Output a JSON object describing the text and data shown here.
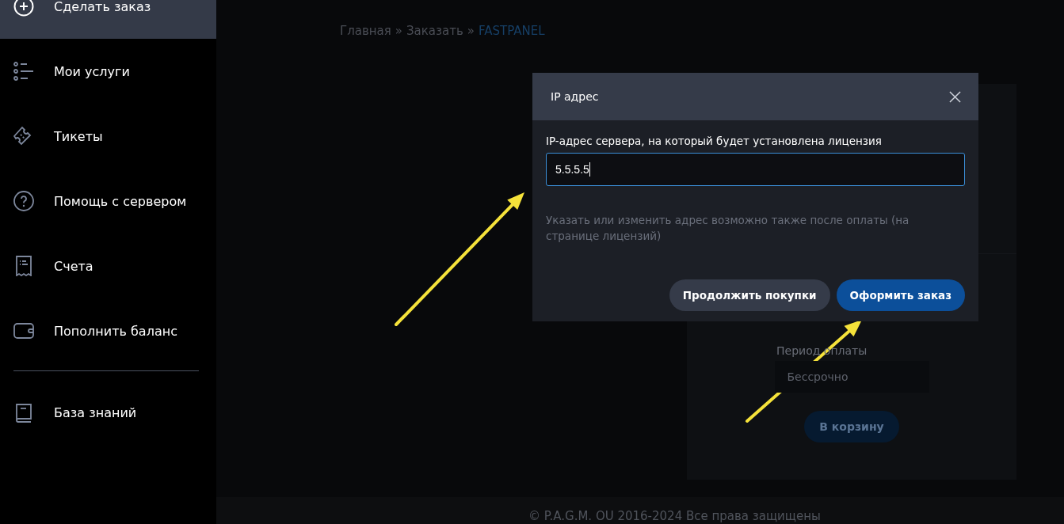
{
  "sidebar": {
    "groups": [
      {
        "items": [
          {
            "label": "Сделать заказ",
            "selected": true
          },
          {
            "label": "Мои услуги",
            "selected": false
          },
          {
            "label": "Тикеты",
            "selected": false
          },
          {
            "label": "Помощь с сервером",
            "selected": false
          },
          {
            "label": "Счета",
            "selected": false
          },
          {
            "label": "Пополнить баланс",
            "selected": false
          }
        ]
      },
      {
        "items": [
          {
            "label": "База знаний",
            "selected": false
          }
        ]
      }
    ]
  },
  "breadcrumb": [
    {
      "label": "Главная",
      "current": false
    },
    {
      "label": "Заказать",
      "current": false
    },
    {
      "label": "FASTPANEL",
      "current": true
    }
  ],
  "breadcrumb_separator": "»",
  "card": {
    "period_label": "Период оплаты",
    "period_value": "Бессрочно",
    "cart_button": "В корзину"
  },
  "footer": {
    "copyright": "© P.A.G.M. OU 2016-2024 Все права защищены"
  },
  "modal": {
    "title": "IP адрес",
    "field_label": "IP-адрес сервера, на который будет установлена лицензия",
    "value": "5.5.5.5",
    "hint": "Указать или изменить адрес возможно также после оплаты (на странице лицензий)",
    "buttons": [
      {
        "label": "Продолжить покупки",
        "kind": "secondary"
      },
      {
        "label": "Оформить заказ",
        "kind": "primary"
      }
    ]
  },
  "annotations": [
    {
      "kind": "arrow",
      "color": "#f5e23a"
    },
    {
      "kind": "arrow",
      "color": "#f5e23a"
    }
  ]
}
